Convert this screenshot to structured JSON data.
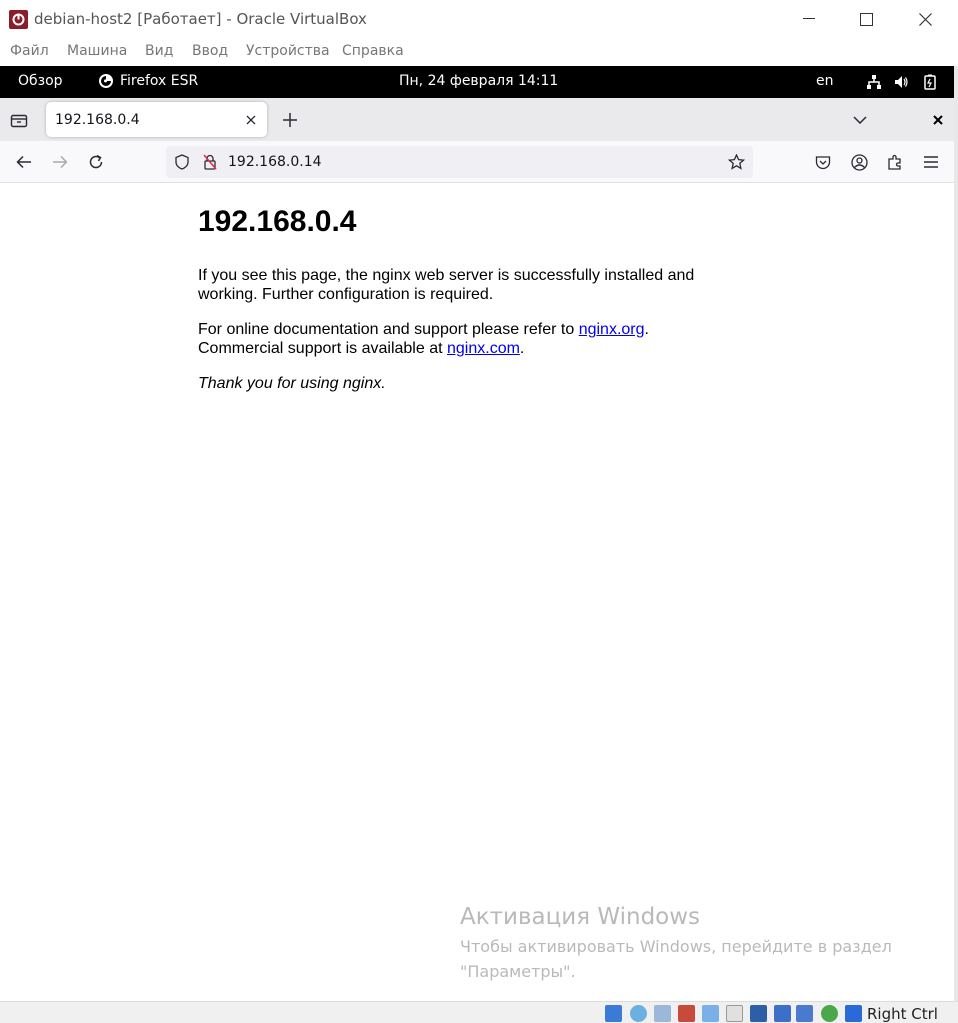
{
  "window": {
    "title": "debian-host2 [Работает] - Oracle VirtualBox"
  },
  "vb_menu": [
    "Файл",
    "Машина",
    "Вид",
    "Ввод",
    "Устройства",
    "Справка"
  ],
  "gnome": {
    "activities": "Обзор",
    "app_name": "Firefox ESR",
    "clock": "Пн, 24 февраля  14:11",
    "keyboard_layout": "en"
  },
  "browser": {
    "tab_title": "192.168.0.4",
    "url": "192.168.0.14"
  },
  "page": {
    "heading": "192.168.0.4",
    "para1": "If you see this page, the nginx web server is successfully installed and working. Further configuration is required.",
    "para2_prefix": "For online documentation and support please refer to ",
    "link1": "nginx.org",
    "para2_mid": ".",
    "para2_line2": "Commercial support is available at ",
    "link2": "nginx.com",
    "para2_end": ".",
    "thanks": "Thank you for using nginx."
  },
  "activation": {
    "title": "Активация Windows",
    "subtitle_line1": "Чтобы активировать Windows, перейдите в раздел",
    "subtitle_line2": "\"Параметры\"."
  },
  "status": {
    "host_key": "Right Ctrl"
  },
  "icons": {
    "app": "virtualbox-icon",
    "firefox": "firefox-icon",
    "network": "network-icon",
    "volume": "volume-icon",
    "battery": "battery-icon"
  }
}
